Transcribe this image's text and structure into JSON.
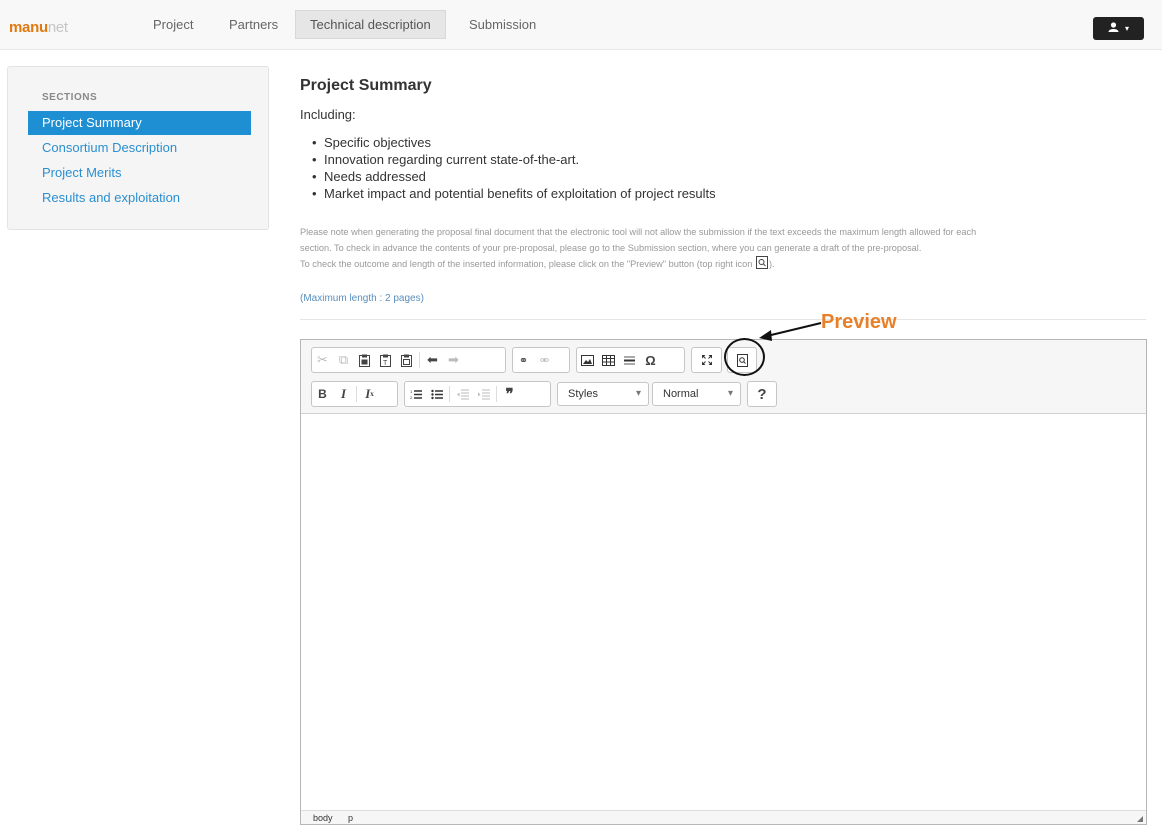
{
  "brand": {
    "part1": "manu",
    "part2": "net"
  },
  "nav": {
    "project": "Project",
    "partners": "Partners",
    "technical": "Technical description",
    "submission": "Submission"
  },
  "user_menu": {
    "icon": "user-icon",
    "caret": "▾"
  },
  "sidebar": {
    "title": "SECTIONS",
    "items": [
      {
        "label": "Project Summary",
        "active": true
      },
      {
        "label": "Consortium Description",
        "active": false
      },
      {
        "label": "Project Merits",
        "active": false
      },
      {
        "label": "Results and exploitation",
        "active": false
      }
    ]
  },
  "main": {
    "title": "Project Summary",
    "including": "Including:",
    "bullets": [
      "Specific objectives",
      "Innovation regarding current state-of-the-art.",
      "Needs addressed",
      "Market impact and potential benefits of exploitation of project results"
    ],
    "note_line1": "Please note when generating the proposal final document that the electronic tool will not allow the submission if the text exceeds the maximum length allowed for each",
    "note_line2": "section. To check in advance the contents of your pre-proposal, please go to the Submission section, where you can generate a draft of the pre-proposal.",
    "note_line3a": "To check the outcome and length of the inserted information, please click on the \"Preview\" button (top right icon",
    "note_line3b": ").",
    "max_length": "(Maximum length : 2 pages)"
  },
  "annotation": {
    "label": "Preview"
  },
  "editor": {
    "styles_combo": "Styles",
    "format_combo": "Normal",
    "help_label": "?",
    "status_path1": "body",
    "status_path2": "p",
    "content": ""
  }
}
